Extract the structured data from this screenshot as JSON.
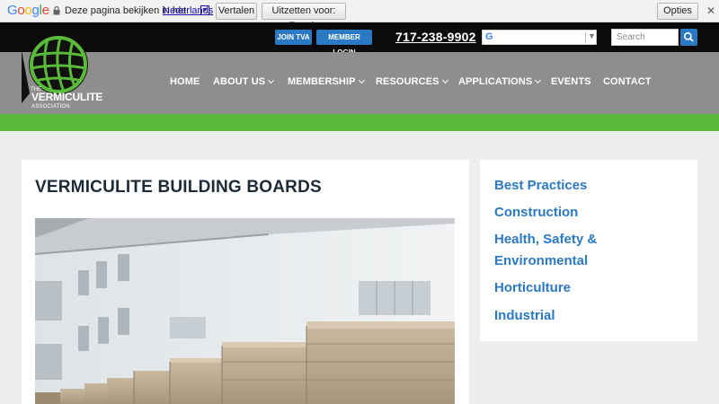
{
  "translate_bar": {
    "logo": "Google",
    "prompt": "Deze pagina bekijken in het:",
    "language": "Nederlands",
    "translate_button": "Vertalen",
    "turn_off_button": "Uitzetten voor: Engels",
    "options_button": "Opties ▼",
    "close": "✕"
  },
  "header": {
    "join_button": "JOIN TVA",
    "login_button": "MEMBER LOGIN",
    "phone": "717-238-9902",
    "search_placeholder": "Search",
    "logo": {
      "the": "THE",
      "name": "VERMICULITE",
      "sub": "ASSOCIATION"
    }
  },
  "nav": {
    "items": [
      {
        "label": "HOME"
      },
      {
        "label": "ABOUT US"
      },
      {
        "label": "MEMBERSHIP"
      },
      {
        "label": "RESOURCES"
      },
      {
        "label": "APPLICATIONS"
      },
      {
        "label": "EVENTS"
      },
      {
        "label": "CONTACT"
      }
    ]
  },
  "main": {
    "title": "VERMICULITE BUILDING BOARDS"
  },
  "sidebar": {
    "links": [
      {
        "label": "Best Practices"
      },
      {
        "label": "Construction"
      },
      {
        "label": "Health, Safety &"
      },
      {
        "label": "Environmental"
      },
      {
        "label": "Horticulture"
      },
      {
        "label": "Industrial"
      }
    ]
  },
  "colors": {
    "accent_blue": "#2a79c2",
    "brand_green": "#5abb3a",
    "nav_gray": "#8e8e8e",
    "header_black": "#0b0b0b"
  }
}
